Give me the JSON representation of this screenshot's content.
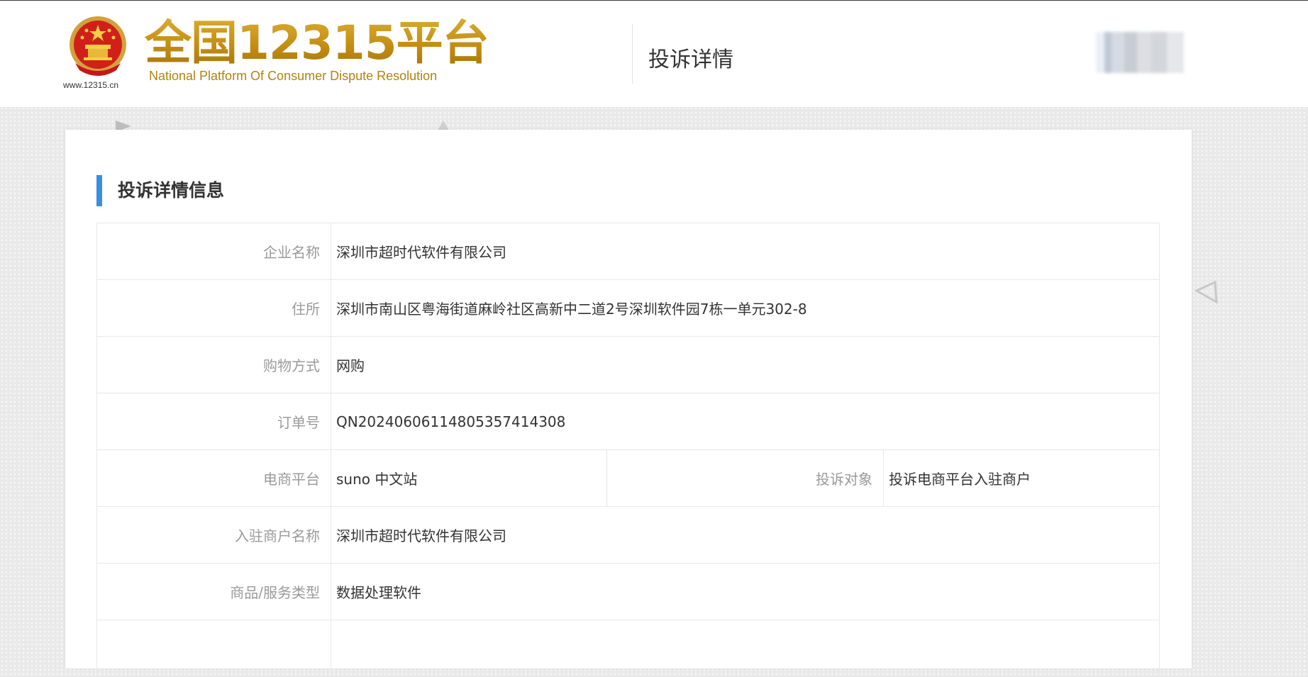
{
  "header": {
    "brand_title": "全国12315平台",
    "brand_subtitle": "National Platform Of Consumer Dispute Resolution",
    "site_url": "www.12315.cn",
    "page_title": "投诉详情"
  },
  "section": {
    "title": "投诉详情信息"
  },
  "details": {
    "company_name": {
      "label": "企业名称",
      "value": "深圳市超时代软件有限公司"
    },
    "address": {
      "label": "住所",
      "value": "深圳市南山区粤海街道麻岭社区高新中二道2号深圳软件园7栋一单元302-8"
    },
    "shopping_method": {
      "label": "购物方式",
      "value": "网购"
    },
    "order_number": {
      "label": "订单号",
      "value": "QN20240606114805357414308"
    },
    "ecommerce_platform": {
      "label": "电商平台",
      "value": "suno 中文站"
    },
    "complaint_target": {
      "label": "投诉对象",
      "value": "投诉电商平台入驻商户"
    },
    "merchant_name": {
      "label": "入驻商户名称",
      "value": "深圳市超时代软件有限公司"
    },
    "goods_type": {
      "label": "商品/服务类型",
      "value": "数据处理软件"
    }
  },
  "colors": {
    "accent_blue": "#3a8ee0",
    "brand_gold": "#c39416",
    "label_gray": "#9a9a9a",
    "text_dark": "#333333",
    "border": "#e8e8e8"
  },
  "icons": {
    "emblem": "national-emblem-icon",
    "avatar": "user-avatar-blurred"
  }
}
